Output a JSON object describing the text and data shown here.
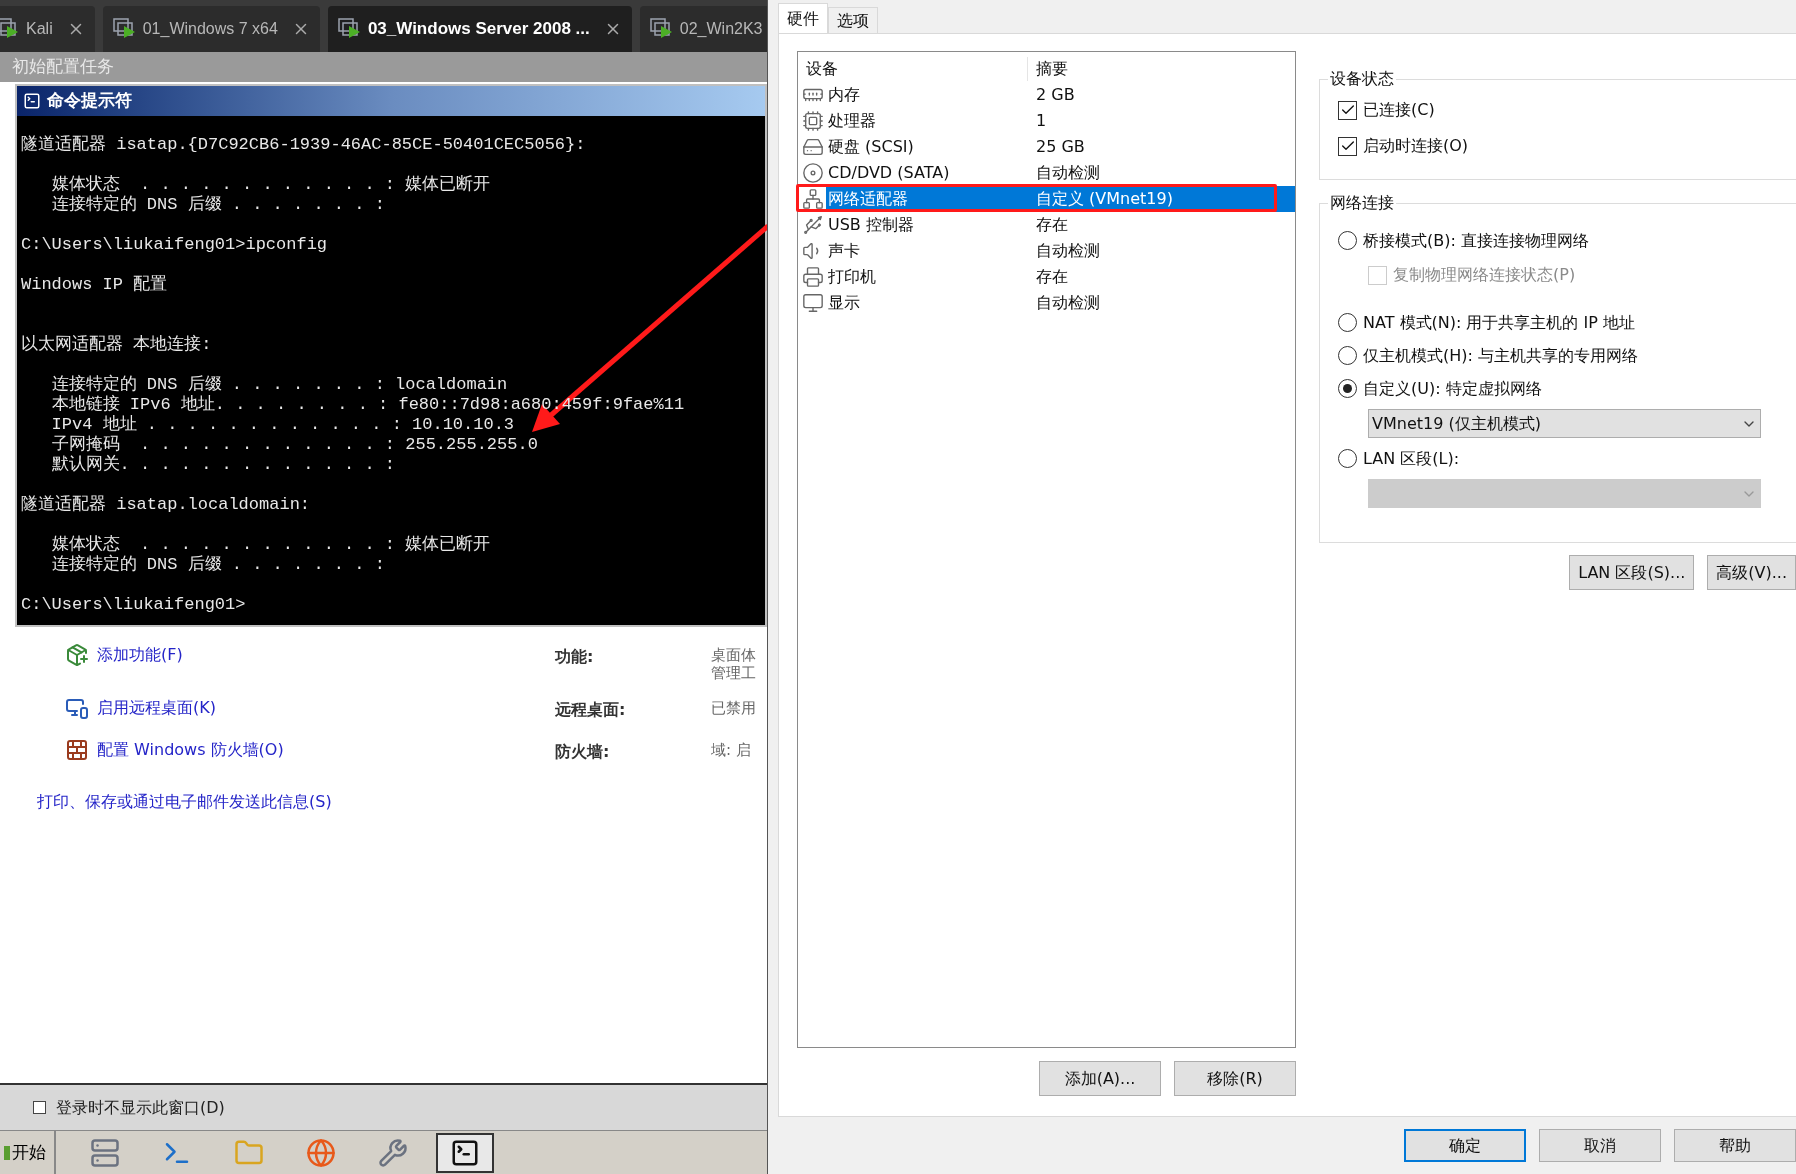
{
  "vm_tabs": [
    {
      "label": "Kali",
      "selected": false
    },
    {
      "label": "01_Windows 7 x64",
      "selected": false
    },
    {
      "label": "03_Windows Server 2008 ...",
      "selected": true
    },
    {
      "label": "02_Win2K3",
      "selected": false
    }
  ],
  "task_window": {
    "title": "初始配置任务"
  },
  "cmd": {
    "title": "命令提示符",
    "blocks": [
      [
        "隧道适配器 isatap.{D7C92CB6-1939-46AC-85CE-50401CEC5056}:"
      ],
      [
        "   媒体状态  . . . . . . . . . . . . : 媒体已断开",
        "   连接特定的 DNS 后缀 . . . . . . . :"
      ],
      [
        "C:\\Users\\liukaifeng01>ipconfig"
      ],
      [
        "Windows IP 配置"
      ],
      [
        "以太网适配器 本地连接:"
      ],
      [
        "   连接特定的 DNS 后缀 . . . . . . . : localdomain",
        "   本地链接 IPv6 地址. . . . . . . . : fe80::7d98:a680:459f:9fae%11",
        "   IPv4 地址 . . . . . . . . . . . . : 10.10.10.3",
        "   子网掩码  . . . . . . . . . . . . : 255.255.255.0",
        "   默认网关. . . . . . . . . . . . . :"
      ],
      [
        "隧道适配器 isatap.localdomain:"
      ],
      [
        "   媒体状态  . . . . . . . . . . . . : 媒体已断开",
        "   连接特定的 DNS 后缀 . . . . . . . :"
      ],
      [
        "C:\\Users\\liukaifeng01>"
      ]
    ]
  },
  "tasks": [
    {
      "kind": "feature",
      "link": "添加功能(F)",
      "label": "功能:",
      "value": [
        "桌面体",
        "管理工"
      ]
    },
    {
      "kind": "remote",
      "link": "启用远程桌面(K)",
      "label": "远程桌面:",
      "value": [
        "已禁用"
      ]
    },
    {
      "kind": "firewall",
      "link": "配置 Windows 防火墙(O)",
      "label": "防火墙:",
      "value": [
        "域: 启"
      ]
    }
  ],
  "print_link": "打印、保存或通过电子邮件发送此信息(S)",
  "dont_show": {
    "label": "登录时不显示此窗口(D)",
    "checked": false
  },
  "taskbar": {
    "start": "开始",
    "apps": [
      {
        "kind": "server",
        "selected": false
      },
      {
        "kind": "powershell",
        "selected": false
      },
      {
        "kind": "folder",
        "selected": false
      },
      {
        "kind": "browser",
        "selected": false
      },
      {
        "kind": "tools",
        "selected": false
      },
      {
        "kind": "cmd",
        "selected": true
      }
    ]
  },
  "settings": {
    "tabs": [
      {
        "label": "硬件",
        "selected": true
      },
      {
        "label": "选项",
        "selected": false
      }
    ],
    "devices": {
      "columns": [
        "设备",
        "摘要"
      ],
      "rows": [
        {
          "kind": "memory",
          "name": "内存",
          "summary": "2 GB",
          "selected": false
        },
        {
          "kind": "cpu",
          "name": "处理器",
          "summary": "1",
          "selected": false
        },
        {
          "kind": "disk",
          "name": "硬盘 (SCSI)",
          "summary": "25 GB",
          "selected": false
        },
        {
          "kind": "cd",
          "name": "CD/DVD (SATA)",
          "summary": "自动检测",
          "selected": false
        },
        {
          "kind": "network",
          "name": "网络适配器",
          "summary": "自定义 (VMnet19)",
          "selected": true
        },
        {
          "kind": "usb",
          "name": "USB 控制器",
          "summary": "存在",
          "selected": false
        },
        {
          "kind": "sound",
          "name": "声卡",
          "summary": "自动检测",
          "selected": false
        },
        {
          "kind": "printer",
          "name": "打印机",
          "summary": "存在",
          "selected": false
        },
        {
          "kind": "display",
          "name": "显示",
          "summary": "自动检测",
          "selected": false
        }
      ]
    },
    "list_buttons": [
      "添加(A)...",
      "移除(R)"
    ],
    "device_status": {
      "title": "设备状态",
      "options": [
        {
          "label": "已连接(C)",
          "checked": true
        },
        {
          "label": "启动时连接(O)",
          "checked": true
        }
      ]
    },
    "network": {
      "title": "网络连接",
      "options": [
        {
          "kind": "radio",
          "label": "桥接模式(B): 直接连接物理网络",
          "selected": false
        },
        {
          "kind": "checkbox",
          "label": "复制物理网络连接状态(P)",
          "checked": false,
          "disabled": true
        },
        {
          "kind": "radio",
          "label": "NAT 模式(N): 用于共享主机的 IP 地址",
          "selected": false
        },
        {
          "kind": "radio",
          "label": "仅主机模式(H): 与主机共享的专用网络",
          "selected": false
        },
        {
          "kind": "radio",
          "label": "自定义(U): 特定虚拟网络",
          "selected": true
        },
        {
          "kind": "dropdown",
          "value": "VMnet19 (仅主机模式)",
          "disabled": false
        },
        {
          "kind": "radio",
          "label": "LAN 区段(L):",
          "selected": false
        },
        {
          "kind": "dropdown",
          "disabled": true
        }
      ]
    },
    "buttons": [
      "LAN 区段(S)...",
      "高级(V)..."
    ],
    "dialog_buttons": [
      {
        "label": "确定",
        "default": true
      },
      {
        "label": "取消",
        "default": false
      },
      {
        "label": "帮助",
        "default": false
      }
    ]
  }
}
